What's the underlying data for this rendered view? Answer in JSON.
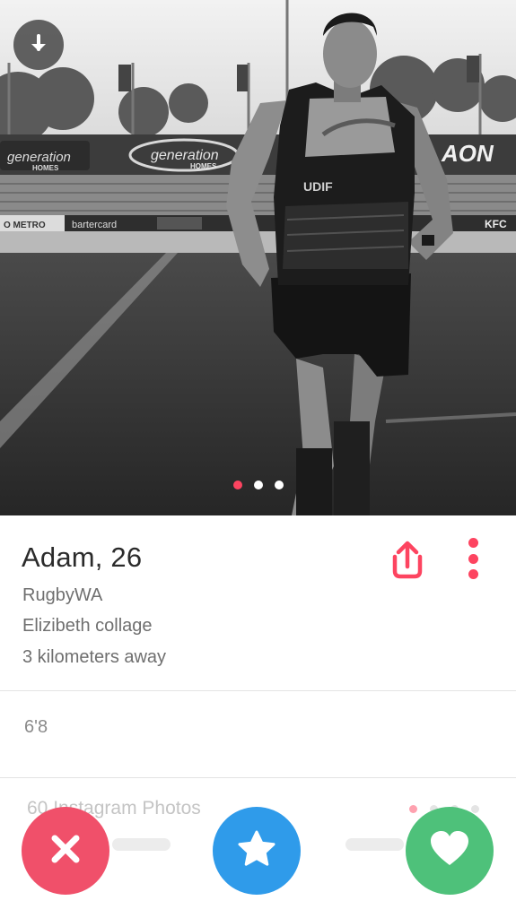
{
  "profile": {
    "name_age": "Adam, 26",
    "job": "RugbyWA",
    "school": "Elizibeth collage",
    "distance": "3 kilometers away",
    "height": "6'8",
    "instagram_label": "60 Instagram Photos"
  },
  "photo": {
    "total_photos": 3,
    "current_index": 0,
    "stadium_signs": [
      "generation HOMES",
      "generation HOMES",
      "AON",
      "METRO",
      "bartercard",
      "KFC"
    ],
    "jersey_text": "UDIF"
  },
  "icons": {
    "download": "download-icon",
    "share": "share-icon",
    "more": "more-vertical-icon",
    "nope": "close-icon",
    "super_like": "star-icon",
    "like": "heart-icon"
  },
  "colors": {
    "accent": "#fd4460",
    "nope": "#f0506a",
    "super_like": "#2f9bea",
    "like": "#4ec17a"
  }
}
